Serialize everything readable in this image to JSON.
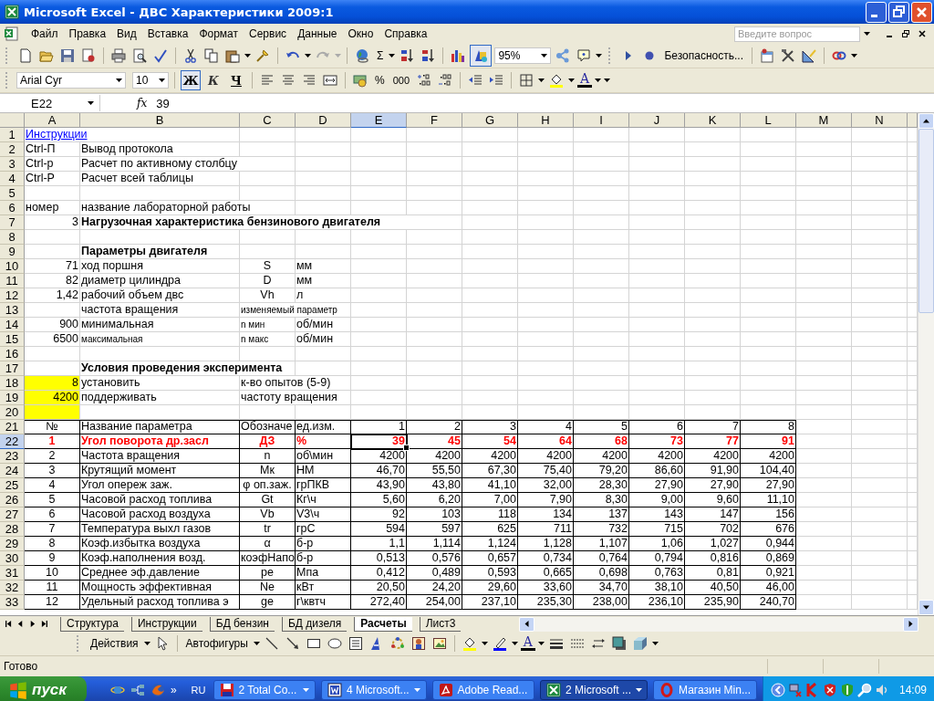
{
  "window": {
    "title": "Microsoft Excel - ДВС Характеристики 2009:1"
  },
  "menu": [
    "Файл",
    "Правка",
    "Вид",
    "Вставка",
    "Формат",
    "Сервис",
    "Данные",
    "Окно",
    "Справка"
  ],
  "help_search": {
    "placeholder": "Введите вопрос"
  },
  "standard_toolbar": {
    "sum": "Σ",
    "zoom": "95%",
    "security": "Безопасность...",
    "drawing_on": true
  },
  "formatting_toolbar": {
    "font": "Arial Cyr",
    "size": "10",
    "styles": [
      {
        "label": "Ж",
        "selected": true
      },
      {
        "label": "К",
        "selected": false
      },
      {
        "label": "Ч",
        "selected": false
      }
    ],
    "percent": "%",
    "thousands": "000",
    "font_color": "A"
  },
  "formula_bar": {
    "name_box": "E22",
    "fx": "fx",
    "value": "39"
  },
  "sheet": {
    "columns": [
      "A",
      "B",
      "C",
      "D",
      "E",
      "F",
      "G",
      "H",
      "I",
      "J",
      "K",
      "L",
      "M",
      "N"
    ],
    "rows": [
      {
        "number": "1",
        "cells": [
          {
            "text": "Инструкции",
            "kind": "link"
          }
        ]
      },
      {
        "number": "2",
        "cells": [
          {
            "text": "Ctrl-П",
            "kind": "text"
          },
          {
            "text": "Вывод протокола",
            "kind": "text"
          }
        ]
      },
      {
        "number": "3",
        "cells": [
          {
            "text": "Ctrl-p",
            "kind": "text"
          },
          {
            "text": "Расчет по активному столбцу",
            "kind": "text"
          }
        ]
      },
      {
        "number": "4",
        "cells": [
          {
            "text": "Ctrl-P",
            "kind": "text"
          },
          {
            "text": "Расчет всей таблицы",
            "kind": "text"
          }
        ]
      },
      {
        "number": "5",
        "cells": []
      },
      {
        "number": "6",
        "cells": [
          {
            "text": "номер",
            "kind": "text"
          },
          {
            "text": "название лабораторной работы",
            "kind": "text"
          }
        ]
      },
      {
        "number": "7",
        "cells": [
          {
            "text": "3",
            "kind": "number"
          },
          {
            "text": "Нагрузочная характеристика бензинового двигателя",
            "kind": "bold"
          }
        ]
      },
      {
        "number": "8",
        "cells": []
      },
      {
        "number": "9",
        "cells": [
          {},
          {
            "text": "Параметры двигателя",
            "kind": "bold"
          }
        ]
      },
      {
        "number": "10",
        "cells": [
          {
            "text": "71",
            "kind": "number"
          },
          {
            "text": "ход поршня",
            "kind": "text"
          },
          {
            "text": "S",
            "kind": "centered"
          },
          {
            "text": "мм",
            "kind": "text"
          }
        ]
      },
      {
        "number": "11",
        "cells": [
          {
            "text": "82",
            "kind": "number"
          },
          {
            "text": "диаметр цилиндра",
            "kind": "text"
          },
          {
            "text": "D",
            "kind": "centered"
          },
          {
            "text": "мм",
            "kind": "text"
          }
        ]
      },
      {
        "number": "12",
        "cells": [
          {
            "text": "1,42",
            "kind": "number"
          },
          {
            "text": "рабочий объем двс",
            "kind": "text"
          },
          {
            "text": "Vh",
            "kind": "centered"
          },
          {
            "text": "л",
            "kind": "text"
          }
        ]
      },
      {
        "number": "13",
        "cells": [
          {},
          {
            "text": "частота вращения",
            "kind": "text"
          },
          {
            "text": "изменяемый параметр",
            "kind": "small"
          }
        ]
      },
      {
        "number": "14",
        "cells": [
          {
            "text": "900",
            "kind": "number"
          },
          {
            "text": "минимальная",
            "kind": "text"
          },
          {
            "text": "n мин",
            "kind": "small"
          },
          {
            "text": "об/мин",
            "kind": "text"
          }
        ]
      },
      {
        "number": "15",
        "cells": [
          {
            "text": "6500",
            "kind": "number"
          },
          {
            "text": "максимальная",
            "kind": "small"
          },
          {
            "text": "n макс",
            "kind": "small"
          },
          {
            "text": "об/мин",
            "kind": "text"
          }
        ]
      },
      {
        "number": "16",
        "cells": []
      },
      {
        "number": "17",
        "cells": [
          {},
          {
            "text": "Условия проведения эксперимента",
            "kind": "bold"
          }
        ]
      },
      {
        "number": "18",
        "cells": [
          {
            "text": "8",
            "kind": "marked-number"
          },
          {
            "text": "установить",
            "kind": "text"
          },
          {
            "text": "к-во опытов (5-9)",
            "kind": "text"
          }
        ]
      },
      {
        "number": "19",
        "cells": [
          {
            "text": "4200",
            "kind": "marked-number"
          },
          {
            "text": "поддерживать",
            "kind": "text"
          },
          {
            "text": "частоту вращения",
            "kind": "text"
          }
        ]
      },
      {
        "number": "20",
        "cells": [
          {
            "kind": "marked"
          }
        ]
      }
    ],
    "table_rows": [
      {
        "number": "21",
        "cells": [
          {
            "text": "№",
            "kind": "centered"
          },
          {
            "text": "Название параметра",
            "kind": "text"
          },
          {
            "text": "Обозначе",
            "kind": "text"
          },
          {
            "text": "ед.изм.",
            "kind": "text"
          },
          {
            "text": "1",
            "kind": "number"
          },
          {
            "text": "2",
            "kind": "number"
          },
          {
            "text": "3",
            "kind": "number"
          },
          {
            "text": "4",
            "kind": "number"
          },
          {
            "text": "5",
            "kind": "number"
          },
          {
            "text": "6",
            "kind": "number"
          },
          {
            "text": "7",
            "kind": "number"
          },
          {
            "text": "8",
            "kind": "number"
          }
        ]
      },
      {
        "number": "22",
        "cells": [
          {
            "text": "1",
            "kind": "accent-centered"
          },
          {
            "text": "Угол поворота др.засл",
            "kind": "accent-text"
          },
          {
            "text": "ДЗ",
            "kind": "accent-centered"
          },
          {
            "text": "%",
            "kind": "accent-text"
          },
          {
            "text": "39",
            "kind": "accent-number",
            "selected": true
          },
          {
            "text": "45",
            "kind": "accent-number"
          },
          {
            "text": "54",
            "kind": "accent-number"
          },
          {
            "text": "64",
            "kind": "accent-number"
          },
          {
            "text": "68",
            "kind": "accent-number"
          },
          {
            "text": "73",
            "kind": "accent-number"
          },
          {
            "text": "77",
            "kind": "accent-number"
          },
          {
            "text": "91",
            "kind": "accent-number"
          }
        ]
      },
      {
        "number": "23",
        "cells": [
          {
            "text": "2",
            "kind": "centered"
          },
          {
            "text": "Частота вращения",
            "kind": "text"
          },
          {
            "text": "n",
            "kind": "centered"
          },
          {
            "text": "об\\мин",
            "kind": "text"
          },
          {
            "text": "4200",
            "kind": "number"
          },
          {
            "text": "4200",
            "kind": "number"
          },
          {
            "text": "4200",
            "kind": "number"
          },
          {
            "text": "4200",
            "kind": "number"
          },
          {
            "text": "4200",
            "kind": "number"
          },
          {
            "text": "4200",
            "kind": "number"
          },
          {
            "text": "4200",
            "kind": "number"
          },
          {
            "text": "4200",
            "kind": "number"
          }
        ]
      },
      {
        "number": "24",
        "cells": [
          {
            "text": "3",
            "kind": "centered"
          },
          {
            "text": "Крутящий момент",
            "kind": "text"
          },
          {
            "text": "Мк",
            "kind": "centered"
          },
          {
            "text": "НМ",
            "kind": "text"
          },
          {
            "text": "46,70",
            "kind": "number"
          },
          {
            "text": "55,50",
            "kind": "number"
          },
          {
            "text": "67,30",
            "kind": "number"
          },
          {
            "text": "75,40",
            "kind": "number"
          },
          {
            "text": "79,20",
            "kind": "number"
          },
          {
            "text": "86,60",
            "kind": "number"
          },
          {
            "text": "91,90",
            "kind": "number"
          },
          {
            "text": "104,40",
            "kind": "number"
          }
        ]
      },
      {
        "number": "25",
        "cells": [
          {
            "text": "4",
            "kind": "centered"
          },
          {
            "text": "Угол опереж заж.",
            "kind": "text"
          },
          {
            "text": "φ оп.заж.",
            "kind": "centered"
          },
          {
            "text": "грПКВ",
            "kind": "text"
          },
          {
            "text": "43,90",
            "kind": "number"
          },
          {
            "text": "43,80",
            "kind": "number"
          },
          {
            "text": "41,10",
            "kind": "number"
          },
          {
            "text": "32,00",
            "kind": "number"
          },
          {
            "text": "28,30",
            "kind": "number"
          },
          {
            "text": "27,90",
            "kind": "number"
          },
          {
            "text": "27,90",
            "kind": "number"
          },
          {
            "text": "27,90",
            "kind": "number"
          }
        ]
      },
      {
        "number": "26",
        "cells": [
          {
            "text": "5",
            "kind": "centered"
          },
          {
            "text": "Часовой расход топлива",
            "kind": "text"
          },
          {
            "text": "Gt",
            "kind": "centered"
          },
          {
            "text": "Кг\\ч",
            "kind": "text"
          },
          {
            "text": "5,60",
            "kind": "number"
          },
          {
            "text": "6,20",
            "kind": "number"
          },
          {
            "text": "7,00",
            "kind": "number"
          },
          {
            "text": "7,90",
            "kind": "number"
          },
          {
            "text": "8,30",
            "kind": "number"
          },
          {
            "text": "9,00",
            "kind": "number"
          },
          {
            "text": "9,60",
            "kind": "number"
          },
          {
            "text": "11,10",
            "kind": "number"
          }
        ]
      },
      {
        "number": "27",
        "cells": [
          {
            "text": "6",
            "kind": "centered"
          },
          {
            "text": "Часовой расход воздуха",
            "kind": "text"
          },
          {
            "text": "Vb",
            "kind": "centered"
          },
          {
            "text": "V3\\ч",
            "kind": "text"
          },
          {
            "text": "92",
            "kind": "number"
          },
          {
            "text": "103",
            "kind": "number"
          },
          {
            "text": "118",
            "kind": "number"
          },
          {
            "text": "134",
            "kind": "number"
          },
          {
            "text": "137",
            "kind": "number"
          },
          {
            "text": "143",
            "kind": "number"
          },
          {
            "text": "147",
            "kind": "number"
          },
          {
            "text": "156",
            "kind": "number"
          }
        ]
      },
      {
        "number": "28",
        "cells": [
          {
            "text": "7",
            "kind": "centered"
          },
          {
            "text": "Температура выхл газов",
            "kind": "text"
          },
          {
            "text": "tr",
            "kind": "centered"
          },
          {
            "text": "грС",
            "kind": "text"
          },
          {
            "text": "594",
            "kind": "number"
          },
          {
            "text": "597",
            "kind": "number"
          },
          {
            "text": "625",
            "kind": "number"
          },
          {
            "text": "711",
            "kind": "number"
          },
          {
            "text": "732",
            "kind": "number"
          },
          {
            "text": "715",
            "kind": "number"
          },
          {
            "text": "702",
            "kind": "number"
          },
          {
            "text": "676",
            "kind": "number"
          }
        ]
      },
      {
        "number": "29",
        "cells": [
          {
            "text": "8",
            "kind": "centered"
          },
          {
            "text": "Коэф.избытка воздуха",
            "kind": "text"
          },
          {
            "text": "α",
            "kind": "centered"
          },
          {
            "text": "б-р",
            "kind": "text"
          },
          {
            "text": "1,1",
            "kind": "number"
          },
          {
            "text": "1,114",
            "kind": "number"
          },
          {
            "text": "1,124",
            "kind": "number"
          },
          {
            "text": "1,128",
            "kind": "number"
          },
          {
            "text": "1,107",
            "kind": "number"
          },
          {
            "text": "1,06",
            "kind": "number"
          },
          {
            "text": "1,027",
            "kind": "number"
          },
          {
            "text": "0,944",
            "kind": "number"
          }
        ]
      },
      {
        "number": "30",
        "cells": [
          {
            "text": "9",
            "kind": "centered"
          },
          {
            "text": "Коэф.наполнения возд.",
            "kind": "text"
          },
          {
            "text": "коэфНапо",
            "kind": "text"
          },
          {
            "text": "б-р",
            "kind": "text"
          },
          {
            "text": "0,513",
            "kind": "number"
          },
          {
            "text": "0,576",
            "kind": "number"
          },
          {
            "text": "0,657",
            "kind": "number"
          },
          {
            "text": "0,734",
            "kind": "number"
          },
          {
            "text": "0,764",
            "kind": "number"
          },
          {
            "text": "0,794",
            "kind": "number"
          },
          {
            "text": "0,816",
            "kind": "number"
          },
          {
            "text": "0,869",
            "kind": "number"
          }
        ]
      },
      {
        "number": "31",
        "cells": [
          {
            "text": "10",
            "kind": "centered"
          },
          {
            "text": "Среднее эф.давление",
            "kind": "text"
          },
          {
            "text": "pe",
            "kind": "centered"
          },
          {
            "text": "Мпа",
            "kind": "text"
          },
          {
            "text": "0,412",
            "kind": "number"
          },
          {
            "text": "0,489",
            "kind": "number"
          },
          {
            "text": "0,593",
            "kind": "number"
          },
          {
            "text": "0,665",
            "kind": "number"
          },
          {
            "text": "0,698",
            "kind": "number"
          },
          {
            "text": "0,763",
            "kind": "number"
          },
          {
            "text": "0,81",
            "kind": "number"
          },
          {
            "text": "0,921",
            "kind": "number"
          }
        ]
      },
      {
        "number": "32",
        "cells": [
          {
            "text": "11",
            "kind": "centered"
          },
          {
            "text": "Мощность эффективная",
            "kind": "text"
          },
          {
            "text": "Ne",
            "kind": "centered"
          },
          {
            "text": "кВт",
            "kind": "text"
          },
          {
            "text": "20,50",
            "kind": "number"
          },
          {
            "text": "24,20",
            "kind": "number"
          },
          {
            "text": "29,60",
            "kind": "number"
          },
          {
            "text": "33,60",
            "kind": "number"
          },
          {
            "text": "34,70",
            "kind": "number"
          },
          {
            "text": "38,10",
            "kind": "number"
          },
          {
            "text": "40,50",
            "kind": "number"
          },
          {
            "text": "46,00",
            "kind": "number"
          }
        ]
      },
      {
        "number": "33",
        "cells": [
          {
            "text": "12",
            "kind": "centered"
          },
          {
            "text": "Удельный расход топлива э",
            "kind": "text"
          },
          {
            "text": "ge",
            "kind": "centered"
          },
          {
            "text": "г\\квтч",
            "kind": "text"
          },
          {
            "text": "272,40",
            "kind": "number"
          },
          {
            "text": "254,00",
            "kind": "number"
          },
          {
            "text": "237,10",
            "kind": "number"
          },
          {
            "text": "235,30",
            "kind": "number"
          },
          {
            "text": "238,00",
            "kind": "number"
          },
          {
            "text": "236,10",
            "kind": "number"
          },
          {
            "text": "235,90",
            "kind": "number"
          },
          {
            "text": "240,70",
            "kind": "number"
          }
        ]
      }
    ]
  },
  "sheet_tabs": [
    {
      "label": "Структура",
      "selected": false
    },
    {
      "label": "Инструкции",
      "selected": false
    },
    {
      "label": "БД бензин",
      "selected": false
    },
    {
      "label": "БД дизеля",
      "selected": false
    },
    {
      "label": "Расчеты",
      "selected": true
    },
    {
      "label": "Лист3",
      "selected": false
    }
  ],
  "drawing_toolbar": {
    "actions": "Действия",
    "autoshapes": "Автофигуры",
    "font_color": "A"
  },
  "status_bar": "Готово",
  "taskbar": {
    "start": "пуск",
    "more": "»",
    "language": "RU",
    "tasks": [
      {
        "label": "2 Total Co...",
        "kind": "files",
        "selected": false
      },
      {
        "label": "4 Microsoft...",
        "kind": "word",
        "selected": false
      },
      {
        "label": "Adobe Read...",
        "kind": "reader",
        "selected": false
      },
      {
        "label": "2 Microsoft ...",
        "kind": "excel",
        "selected": true
      },
      {
        "label": "Магазин Min...",
        "kind": "browser",
        "selected": false
      }
    ],
    "clock": "14:09"
  }
}
